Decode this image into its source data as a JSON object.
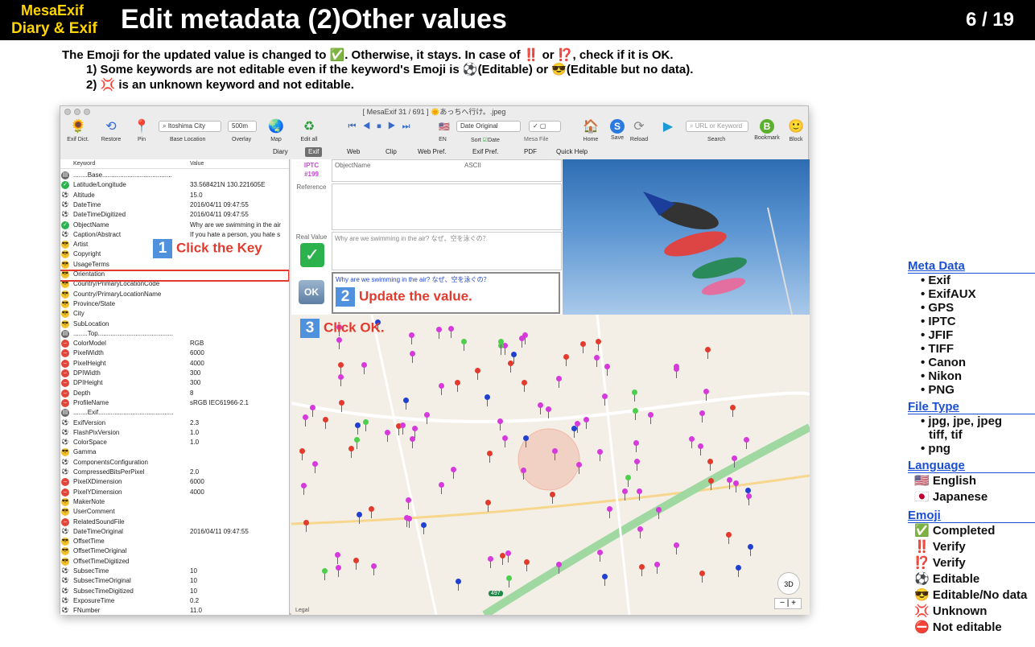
{
  "header": {
    "brand_line1": "MesaExif",
    "brand_line2": "Diary & Exif",
    "title": "Edit metadata (2)Other values",
    "page": "6 / 19"
  },
  "intro": {
    "line1": "The Emoji for the updated value is changed to ✅. Otherwise, it stays. In case of ‼️ or ⁉️, check if it is OK.",
    "line2": "1) Some keywords are not editable even if the keyword's Emoji is ⚽️(Editable) or 😎(Editable but no data).",
    "line3": "2) 💢 is an unknown keyword and not editable."
  },
  "window": {
    "title": "[ MesaExif 31 / 691 ]  🌞あっちへ行け。.jpeg",
    "toolbar": {
      "exif_dict": "Exif Dict.",
      "restore": "Restore",
      "pin": "Pin",
      "base_location_value": "Itoshima City",
      "base_location": "Base Location",
      "overlay_value": "500m",
      "overlay": "Overlay",
      "map": "Map",
      "edit_all": "Edit all",
      "lang": "EN",
      "sort_value": "Date Original",
      "sort": "Sort",
      "sort_date": "Date",
      "mesa_file": "Mesa File",
      "home": "Home",
      "save": "Save",
      "reload": "Reload",
      "search_placeholder": "URL or Keyword",
      "search": "Search",
      "bookmark": "Bookmark",
      "block": "Block"
    },
    "tabs": [
      "Diary",
      "Exif",
      "Web",
      "Clip",
      "Web Pref.",
      "Exif Pref.",
      "PDF",
      "Quick Help"
    ],
    "table": {
      "col_keyword": "Keyword",
      "col_value": "Value",
      "rows": [
        {
          "e": "sep",
          "k": "........Base.......................................",
          "v": ""
        },
        {
          "e": "ok",
          "k": "Latitude/Longitude",
          "v": "33.568421N 130.221605E"
        },
        {
          "e": "ball",
          "k": "Altitude",
          "v": "15.0"
        },
        {
          "e": "ball",
          "k": "DateTime",
          "v": "2016/04/11 09:47:55"
        },
        {
          "e": "ball",
          "k": "DateTimeDigitized",
          "v": "2016/04/11 09:47:55"
        },
        {
          "e": "ok",
          "k": "ObjectName",
          "v": "Why are we swimming in the air"
        },
        {
          "e": "ball",
          "k": "Caption/Abstract",
          "v": "If you hate a person, you hate s"
        },
        {
          "e": "cool",
          "k": "Artist",
          "v": ""
        },
        {
          "e": "cool",
          "k": "Copyright",
          "v": ""
        },
        {
          "e": "cool",
          "k": "UsageTerms",
          "v": ""
        },
        {
          "e": "cool",
          "k": "Orientation",
          "v": ""
        },
        {
          "e": "cool",
          "k": "Country/PrimaryLocationCode",
          "v": ""
        },
        {
          "e": "cool",
          "k": "Country/PrimaryLocationName",
          "v": ""
        },
        {
          "e": "cool",
          "k": "Province/State",
          "v": ""
        },
        {
          "e": "cool",
          "k": "City",
          "v": ""
        },
        {
          "e": "cool",
          "k": "SubLocation",
          "v": ""
        },
        {
          "e": "sep",
          "k": "........Top..........................................",
          "v": ""
        },
        {
          "e": "no",
          "k": "ColorModel",
          "v": "RGB"
        },
        {
          "e": "no",
          "k": "PixelWidth",
          "v": "6000"
        },
        {
          "e": "no",
          "k": "PixelHeight",
          "v": "4000"
        },
        {
          "e": "no",
          "k": "DPIWidth",
          "v": "300"
        },
        {
          "e": "no",
          "k": "DPIHeight",
          "v": "300"
        },
        {
          "e": "no",
          "k": "Depth",
          "v": "8"
        },
        {
          "e": "no",
          "k": "ProfileName",
          "v": "sRGB IEC61966-2.1"
        },
        {
          "e": "sep",
          "k": "........Exif..........................................",
          "v": ""
        },
        {
          "e": "ball",
          "k": "ExifVersion",
          "v": "2.3"
        },
        {
          "e": "ball",
          "k": "FlashPixVersion",
          "v": "1.0"
        },
        {
          "e": "ball",
          "k": "ColorSpace",
          "v": "1.0"
        },
        {
          "e": "cool",
          "k": "Gamma",
          "v": ""
        },
        {
          "e": "ball",
          "k": "ComponentsConfiguration",
          "v": ""
        },
        {
          "e": "ball",
          "k": "CompressedBitsPerPixel",
          "v": "2.0"
        },
        {
          "e": "no",
          "k": "PixelXDimension",
          "v": "6000"
        },
        {
          "e": "no",
          "k": "PixelYDimension",
          "v": "4000"
        },
        {
          "e": "cool",
          "k": "MakerNote",
          "v": ""
        },
        {
          "e": "cool",
          "k": "UserComment",
          "v": ""
        },
        {
          "e": "no",
          "k": "RelatedSoundFile",
          "v": ""
        },
        {
          "e": "ball",
          "k": "DateTimeOriginal",
          "v": "2016/04/11 09:47:55"
        },
        {
          "e": "cool",
          "k": "OffsetTime",
          "v": ""
        },
        {
          "e": "cool",
          "k": "OffsetTimeOriginal",
          "v": ""
        },
        {
          "e": "cool",
          "k": "OffsetTimeDigitized",
          "v": ""
        },
        {
          "e": "ball",
          "k": "SubsecTime",
          "v": "10"
        },
        {
          "e": "ball",
          "k": "SubsecTimeOriginal",
          "v": "10"
        },
        {
          "e": "ball",
          "k": "SubsecTimeDigitized",
          "v": "10"
        },
        {
          "e": "ball",
          "k": "ExposureTime",
          "v": "0.2"
        },
        {
          "e": "ball",
          "k": "FNumber",
          "v": "11.0"
        }
      ]
    },
    "editor": {
      "tag_group": "IPTC",
      "tag_id": "#199",
      "object_name_label": "ObjectName",
      "type": "ASCII",
      "reference_label": "Reference",
      "real_value_label": "Real Value",
      "real_value": "Why are we swimming in the air? なぜ、空を泳ぐの？",
      "input_value": "Why are we swimming in the air? なぜ、空を泳ぐの？",
      "ok_button": "OK"
    },
    "map": {
      "btn_3d": "3D",
      "zoom_out": "−",
      "zoom_in": "+",
      "legal": "Legal",
      "route": "497"
    }
  },
  "callouts": {
    "step1": "Click the Key",
    "step2": "Update the value.",
    "step3": "Click OK.",
    "n1": "1",
    "n2": "2",
    "n3": "3"
  },
  "sidebar": {
    "meta_data_title": "Meta Data",
    "meta_data": [
      "Exif",
      "ExifAUX",
      "GPS",
      "IPTC",
      "JFIF",
      "TIFF",
      "Canon",
      "Nikon",
      "PNG"
    ],
    "file_type_title": "File Type",
    "file_type_1": "jpg, jpe, jpeg",
    "file_type_2": "tiff, tif",
    "file_type_3": "png",
    "language_title": "Language",
    "languages": [
      "English",
      "Japanese"
    ],
    "emoji_title": "Emoji",
    "emoji": [
      {
        "sym": "✅",
        "label": "Completed"
      },
      {
        "sym": "‼️",
        "label": "Verify"
      },
      {
        "sym": "⁉️",
        "label": "Verify"
      },
      {
        "sym": "⚽️",
        "label": "Editable"
      },
      {
        "sym": "😎",
        "label": "Editable/No data"
      },
      {
        "sym": "💢",
        "label": "Unknown"
      },
      {
        "sym": "⛔️",
        "label": "Not editable"
      }
    ]
  },
  "colors": {
    "accent_red": "#e43a2d",
    "step_blue": "#4f91dd",
    "heading_blue": "#1b4fd1",
    "brand_yellow": "#ffd400"
  }
}
